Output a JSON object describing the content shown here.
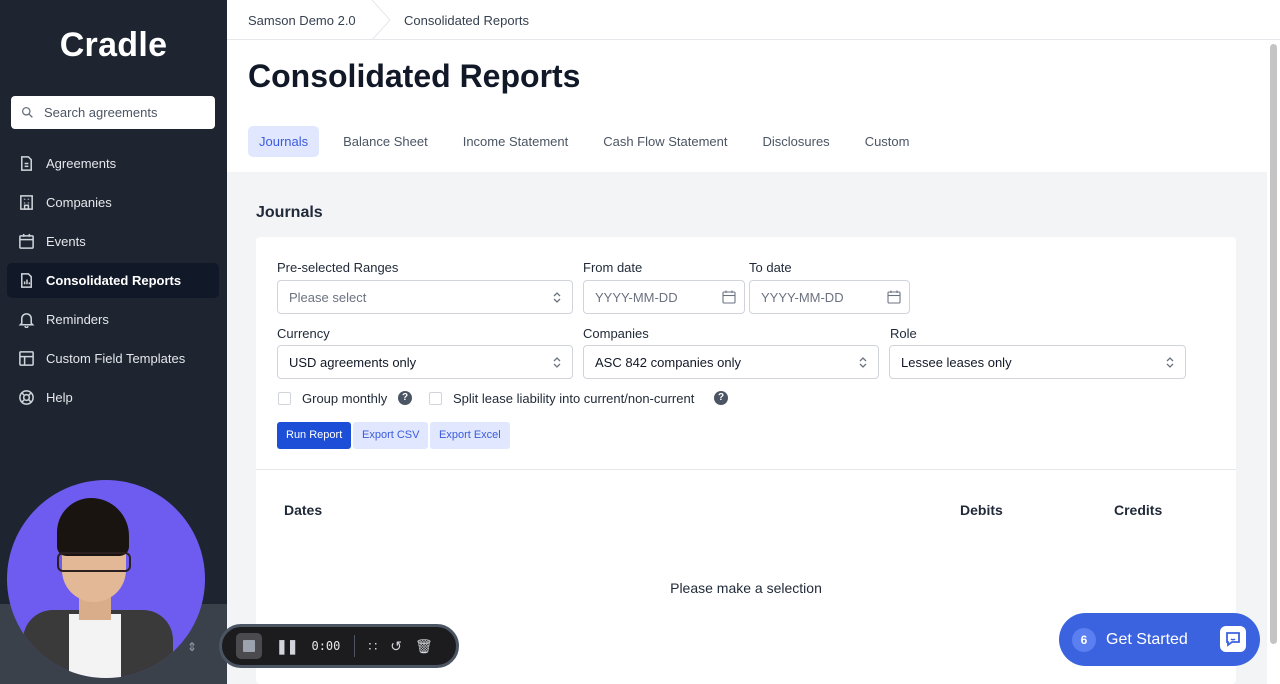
{
  "sidebar": {
    "logo": "Cradle",
    "search_placeholder": "Search agreements",
    "items": [
      {
        "label": "Agreements",
        "icon": "document-icon"
      },
      {
        "label": "Companies",
        "icon": "building-icon"
      },
      {
        "label": "Events",
        "icon": "calendar-icon"
      },
      {
        "label": "Consolidated Reports",
        "icon": "report-icon",
        "active": true
      },
      {
        "label": "Reminders",
        "icon": "bell-icon"
      },
      {
        "label": "Custom Field Templates",
        "icon": "template-icon"
      },
      {
        "label": "Help",
        "icon": "lifebuoy-icon"
      }
    ]
  },
  "breadcrumb": {
    "workspace": "Samson Demo 2.0",
    "current": "Consolidated Reports"
  },
  "page": {
    "title": "Consolidated Reports",
    "tabs": [
      "Journals",
      "Balance Sheet",
      "Income Statement",
      "Cash Flow Statement",
      "Disclosures",
      "Custom"
    ],
    "active_tab": "Journals"
  },
  "journals": {
    "section_title": "Journals",
    "preselected_label": "Pre-selected Ranges",
    "preselected_placeholder": "Please select",
    "from_label": "From date",
    "from_placeholder": "YYYY-MM-DD",
    "to_label": "To date",
    "to_placeholder": "YYYY-MM-DD",
    "currency_label": "Currency",
    "currency_value": "USD agreements only",
    "companies_label": "Companies",
    "companies_value": "ASC 842 companies only",
    "role_label": "Role",
    "role_value": "Lessee leases only",
    "group_monthly_label": "Group monthly",
    "split_label": "Split lease liability into current/non-current",
    "help_glyph": "?",
    "run_label": "Run Report",
    "export_csv_label": "Export CSV",
    "export_excel_label": "Export Excel",
    "columns": [
      "Dates",
      "Debits",
      "Credits"
    ],
    "empty_message": "Please make a selection"
  },
  "recorder": {
    "time": "0:00"
  },
  "get_started": {
    "count": "6",
    "label": "Get Started"
  },
  "colors": {
    "sidebar_bg": "#1e2530",
    "accent": "#1d4ed8",
    "tab_active_bg": "#e0e7ff",
    "get_started_bg": "#3b63e0"
  }
}
